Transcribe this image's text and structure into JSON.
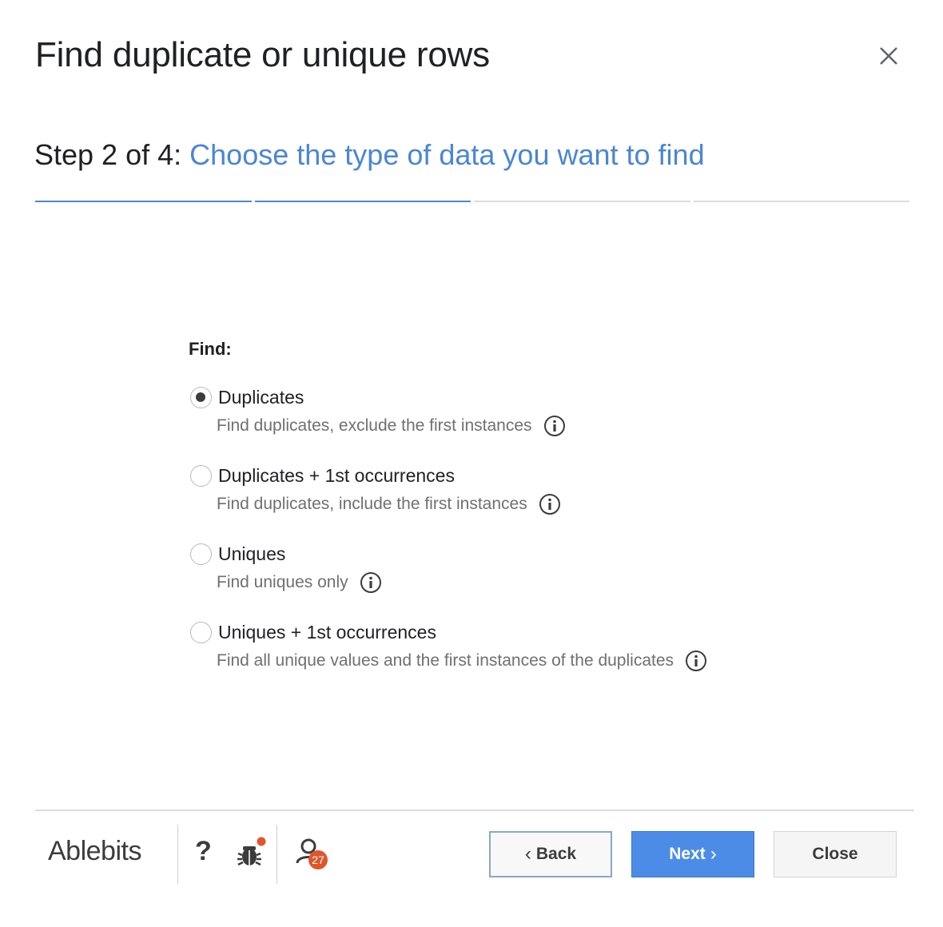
{
  "dialog": {
    "title": "Find duplicate or unique rows",
    "close_icon": "close-icon"
  },
  "step": {
    "prefix": "Step 2 of 4:",
    "description": "Choose the type of data you want to find",
    "current": 2,
    "total": 4
  },
  "find": {
    "label": "Find:",
    "selected": "Duplicates",
    "options": [
      {
        "label": "Duplicates",
        "description": "Find duplicates, exclude the first instances",
        "checked": true
      },
      {
        "label": "Duplicates + 1st occurrences",
        "description": "Find duplicates, include the first instances",
        "checked": false
      },
      {
        "label": "Uniques",
        "description": "Find uniques only",
        "checked": false
      },
      {
        "label": "Uniques + 1st occurrences",
        "description": "Find all unique values and the first instances of the duplicates",
        "checked": false
      }
    ]
  },
  "footer": {
    "brand": "Ablebits",
    "help_label": "?",
    "notification_count": "27",
    "back_label": "Back",
    "next_label": "Next",
    "close_label": "Close"
  },
  "colors": {
    "accent": "#4a86d4",
    "next_button": "#4d8ce6",
    "badge": "#e0562c"
  }
}
